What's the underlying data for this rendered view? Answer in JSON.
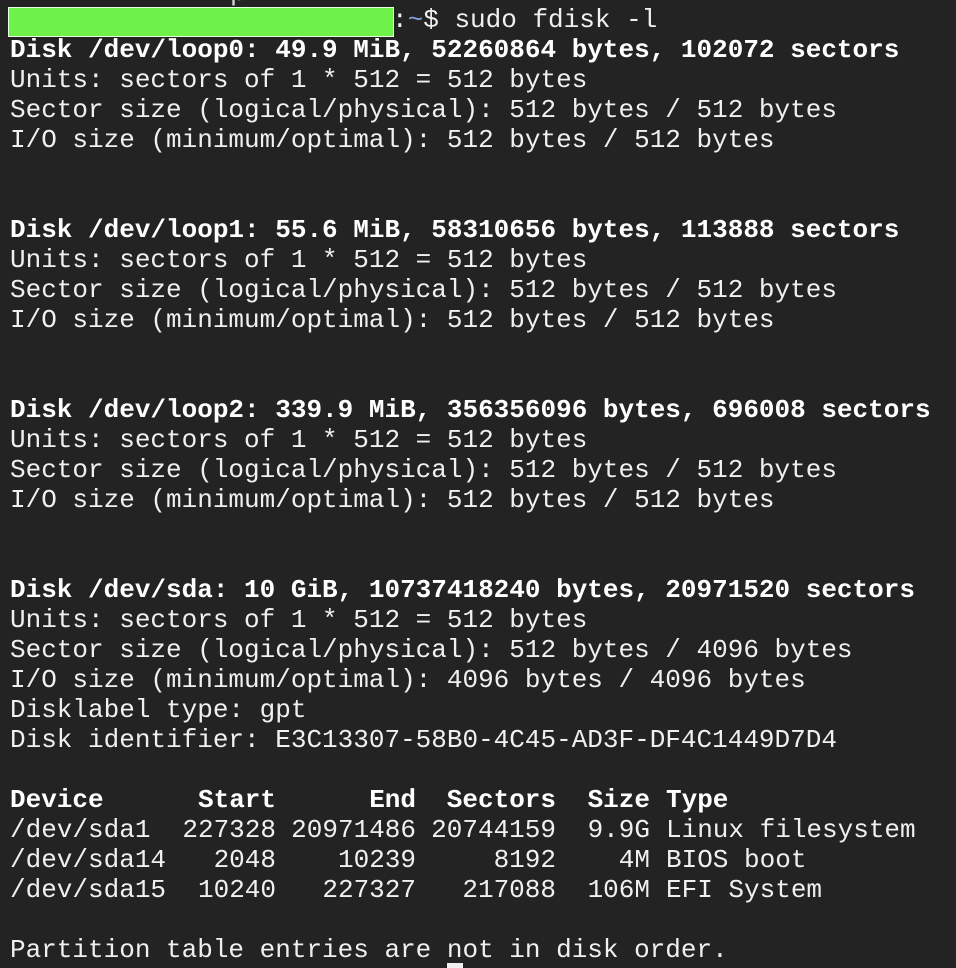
{
  "prompt": {
    "partial_previous_line": "p",
    "redacted_user_host": true,
    "redaction_color": "#6ef24a",
    "separator": ":",
    "cwd": "~",
    "symbol": "$",
    "command": "sudo fdisk -l"
  },
  "disks": [
    {
      "header": "Disk /dev/loop0: 49.9 MiB, 52260864 bytes, 102072 sectors",
      "units": "Units: sectors of 1 * 512 = 512 bytes",
      "sector_size": "Sector size (logical/physical): 512 bytes / 512 bytes",
      "io_size": "I/O size (minimum/optimal): 512 bytes / 512 bytes"
    },
    {
      "header": "Disk /dev/loop1: 55.6 MiB, 58310656 bytes, 113888 sectors",
      "units": "Units: sectors of 1 * 512 = 512 bytes",
      "sector_size": "Sector size (logical/physical): 512 bytes / 512 bytes",
      "io_size": "I/O size (minimum/optimal): 512 bytes / 512 bytes"
    },
    {
      "header": "Disk /dev/loop2: 339.9 MiB, 356356096 bytes, 696008 sectors",
      "units": "Units: sectors of 1 * 512 = 512 bytes",
      "sector_size": "Sector size (logical/physical): 512 bytes / 512 bytes",
      "io_size": "I/O size (minimum/optimal): 512 bytes / 512 bytes"
    },
    {
      "header": "Disk /dev/sda: 10 GiB, 10737418240 bytes, 20971520 sectors",
      "units": "Units: sectors of 1 * 512 = 512 bytes",
      "sector_size": "Sector size (logical/physical): 512 bytes / 4096 bytes",
      "io_size": "I/O size (minimum/optimal): 4096 bytes / 4096 bytes",
      "disklabel": "Disklabel type: gpt",
      "identifier": "Disk identifier: E3C13307-58B0-4C45-AD3F-DF4C1449D7D4"
    }
  ],
  "partition_table": {
    "columns": [
      "Device",
      "Start",
      "End",
      "Sectors",
      "Size",
      "Type"
    ],
    "rows": [
      [
        "/dev/sda1",
        "227328",
        "20971486",
        "20744159",
        "9.9G",
        "Linux filesystem"
      ],
      [
        "/dev/sda14",
        "2048",
        "10239",
        "8192",
        "4M",
        "BIOS boot"
      ],
      [
        "/dev/sda15",
        "10240",
        "227327",
        "217088",
        "106M",
        "EFI System"
      ]
    ]
  },
  "footer_message": "Partition table entries are not in disk order."
}
